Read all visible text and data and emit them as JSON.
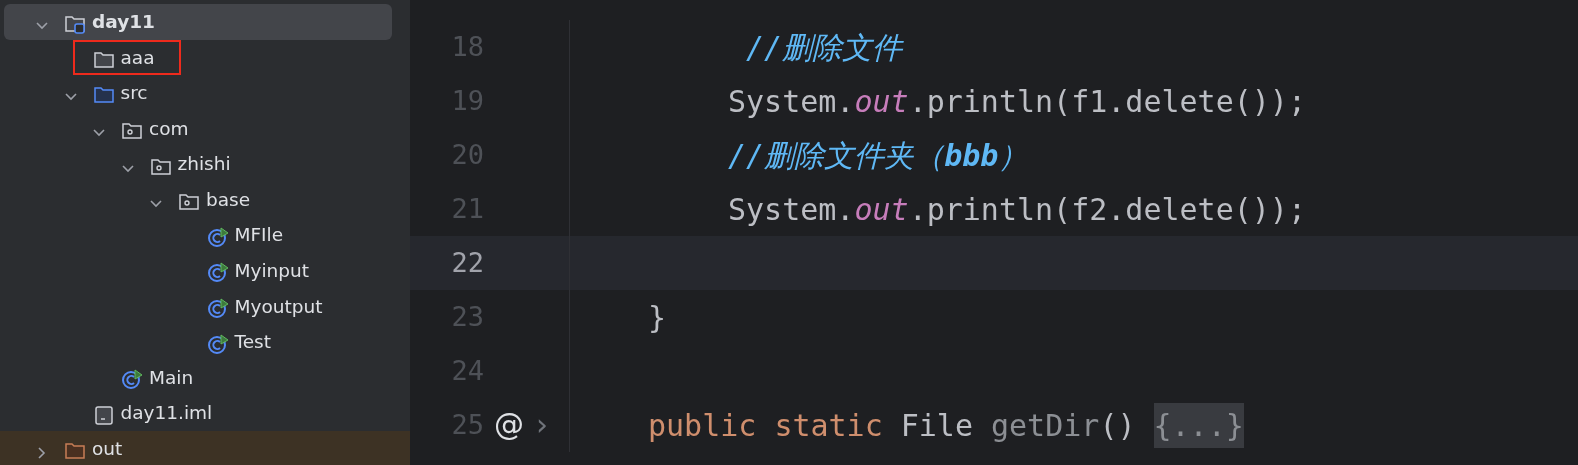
{
  "project_tree": [
    {
      "label": "day11",
      "kind": "module",
      "selected": true,
      "expanded": true,
      "children": [
        {
          "label": "aaa",
          "kind": "folder",
          "selected": false,
          "highlighted": true
        },
        {
          "label": "src",
          "kind": "source-folder",
          "selected": false,
          "expanded": true,
          "children": [
            {
              "label": "com",
              "kind": "package",
              "selected": false,
              "expanded": true,
              "children": [
                {
                  "label": "zhishi",
                  "kind": "package",
                  "selected": false,
                  "expanded": true,
                  "children": [
                    {
                      "label": "base",
                      "kind": "package",
                      "selected": false,
                      "expanded": true,
                      "children": [
                        {
                          "label": "MFIle",
                          "kind": "class",
                          "selected": false
                        },
                        {
                          "label": "Myinput",
                          "kind": "class",
                          "selected": false
                        },
                        {
                          "label": "Myoutput",
                          "kind": "class",
                          "selected": false
                        },
                        {
                          "label": "Test",
                          "kind": "class",
                          "selected": false
                        }
                      ]
                    }
                  ]
                }
              ]
            },
            {
              "label": "Main",
              "kind": "class",
              "selected": false
            }
          ]
        },
        {
          "label": "day11.iml",
          "kind": "iml",
          "selected": false
        }
      ]
    },
    {
      "label": "out",
      "kind": "excluded-folder",
      "selected": false,
      "expanded": false
    }
  ],
  "editor": {
    "lines": [
      {
        "number": "18",
        "current": false,
        "kind": "indented-comment",
        "tokens": [
          {
            "kind": "comment",
            "text": "//删除文件"
          }
        ]
      },
      {
        "number": "19",
        "current": false,
        "kind": "statement",
        "tokens": [
          {
            "kind": "plain",
            "text": "System."
          },
          {
            "kind": "field",
            "text": "out"
          },
          {
            "kind": "plain",
            "text": ".println(f1.delete());"
          }
        ]
      },
      {
        "number": "20",
        "current": false,
        "kind": "statement",
        "tokens": [
          {
            "kind": "comment",
            "text": "//删除文件夹（**bbb**）"
          }
        ]
      },
      {
        "number": "21",
        "current": false,
        "kind": "statement",
        "tokens": [
          {
            "kind": "plain",
            "text": "System."
          },
          {
            "kind": "field",
            "text": "out"
          },
          {
            "kind": "plain",
            "text": ".println(f2.delete());"
          }
        ]
      },
      {
        "number": "22",
        "current": true,
        "kind": "blank"
      },
      {
        "number": "23",
        "current": false,
        "kind": "member",
        "tokens": [
          {
            "kind": "plain",
            "text": "}"
          }
        ]
      },
      {
        "number": "24",
        "current": false,
        "kind": "blank"
      },
      {
        "number": "25",
        "current": false,
        "kind": "member",
        "gutter": {
          "annotation": "@",
          "fold": "›"
        },
        "tokens": [
          {
            "kind": "keyword",
            "text": "public"
          },
          {
            "kind": "keyword",
            "text": "static"
          },
          {
            "kind": "plain",
            "text": "File"
          },
          {
            "kind": "unused",
            "text": "getDir"
          },
          {
            "kind": "plain",
            "text": "()"
          },
          {
            "kind": "folded",
            "text": "{...}"
          }
        ]
      }
    ]
  }
}
